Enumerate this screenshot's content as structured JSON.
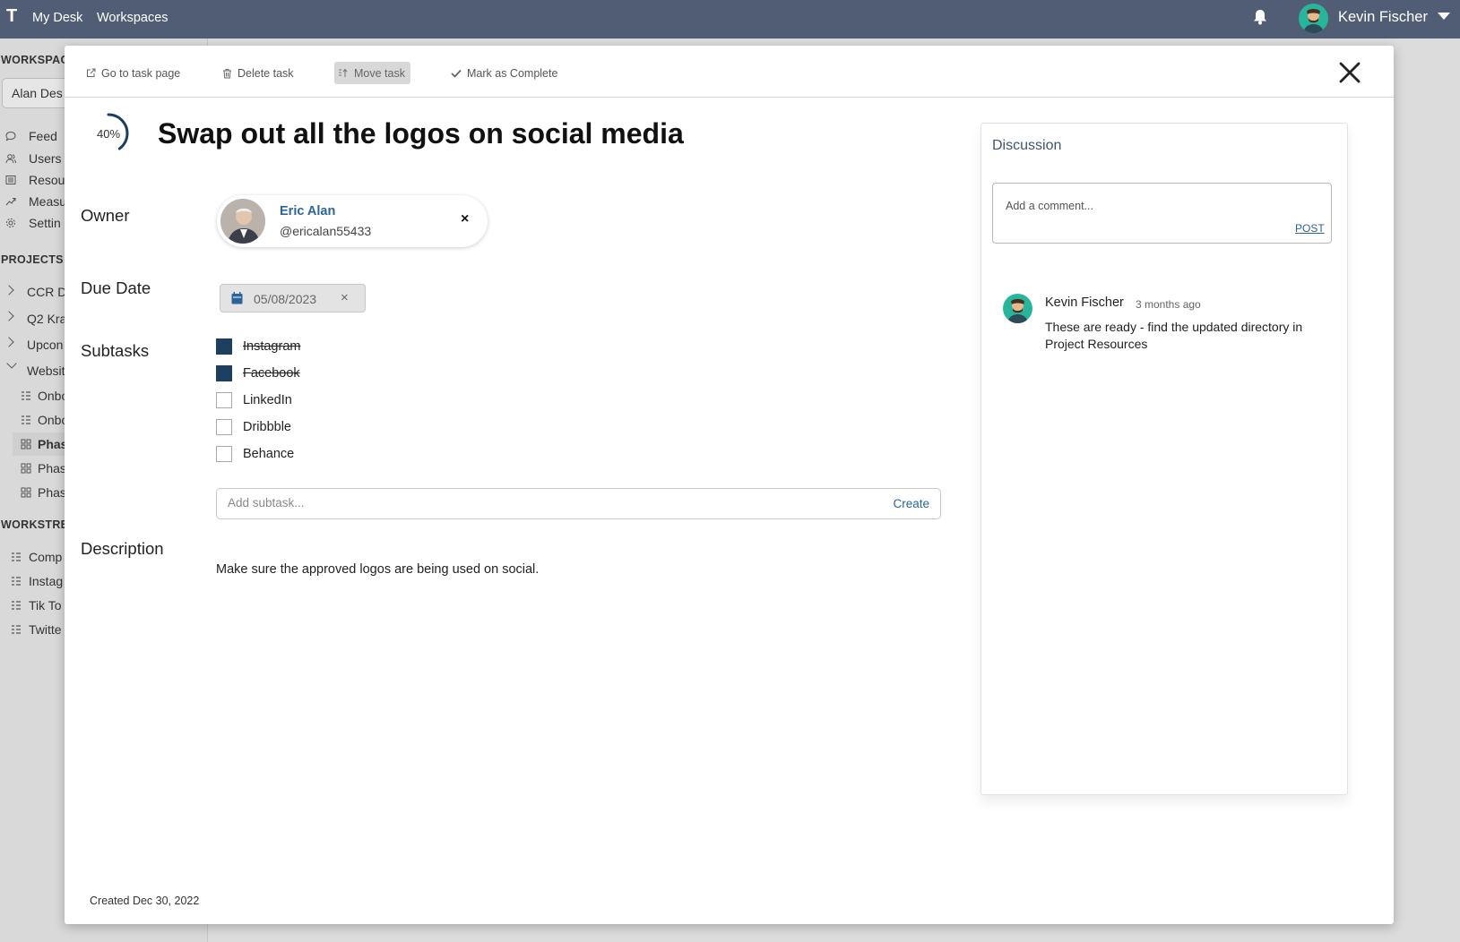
{
  "topbar": {
    "logo": "T",
    "nav": [
      "My Desk",
      "Workspaces"
    ],
    "user_name": "Kevin Fischer",
    "icons": [
      "bell-icon",
      "user-avatar",
      "caret-down-icon"
    ]
  },
  "sidebar": {
    "workspace_heading": "WORKSPAC",
    "workspace_select": "Alan Des",
    "nav": [
      {
        "label": "Feed",
        "icon": "feed-icon"
      },
      {
        "label": "Users",
        "icon": "users-icon"
      },
      {
        "label": "Resou",
        "icon": "resources-icon"
      },
      {
        "label": "Measu",
        "icon": "measures-icon"
      },
      {
        "label": "Settin",
        "icon": "settings-icon"
      }
    ],
    "projects_heading": "PROJECTS",
    "projects": [
      {
        "label": "CCR De",
        "expanded": false
      },
      {
        "label": "Q2 Kra",
        "expanded": false
      },
      {
        "label": "Upcon",
        "expanded": false
      },
      {
        "label": "Websit",
        "expanded": true
      }
    ],
    "project_children": [
      {
        "label": "Onbo",
        "icon": "list-icon",
        "selected": false
      },
      {
        "label": "Onbo",
        "icon": "list-icon",
        "selected": false
      },
      {
        "label": "Phas",
        "icon": "board-icon",
        "selected": true
      },
      {
        "label": "Phas",
        "icon": "board-icon",
        "selected": false
      },
      {
        "label": "Phas",
        "icon": "board-icon",
        "selected": false
      }
    ],
    "workstreams_heading": "WORKSTREA",
    "workstreams": [
      "Comp",
      "Instag",
      "Tik To",
      "Twitte"
    ]
  },
  "modal": {
    "toolbar": {
      "go_to_task": "Go to task page",
      "delete_task": "Delete task",
      "move_task": "Move task",
      "mark_complete": "Mark as Complete"
    },
    "progress": 0.4,
    "progress_label": "40%",
    "title": "Swap out all the logos on social media",
    "labels": {
      "owner": "Owner",
      "due_date": "Due Date",
      "subtasks": "Subtasks",
      "description": "Description"
    },
    "owner": {
      "name": "Eric Alan",
      "handle": "@ericalan55433",
      "remove": "×"
    },
    "due_date": {
      "value": "05/08/2023",
      "clear": "×"
    },
    "subtasks": [
      {
        "label": "Instagram",
        "done": true
      },
      {
        "label": "Facebook",
        "done": true
      },
      {
        "label": "LinkedIn",
        "done": false
      },
      {
        "label": "Dribbble",
        "done": false
      },
      {
        "label": "Behance",
        "done": false
      }
    ],
    "add_subtask": {
      "placeholder": "Add subtask...",
      "create_label": "Create"
    },
    "description": "Make sure the approved logos are being used on social.",
    "created": "Created Dec 30, 2022"
  },
  "discussion": {
    "title": "Discussion",
    "comment_placeholder": "Add a comment...",
    "post_label": "POST",
    "comments": [
      {
        "author": "Kevin Fischer",
        "time": "3 months ago",
        "text": "These are ready - find the updated directory in Project Resources"
      }
    ]
  },
  "colors": {
    "topbar": "#515d75",
    "accent_blue": "#2a6598",
    "checkbox_checked": "#1d4060",
    "avatar_bg": "#28b59c"
  }
}
